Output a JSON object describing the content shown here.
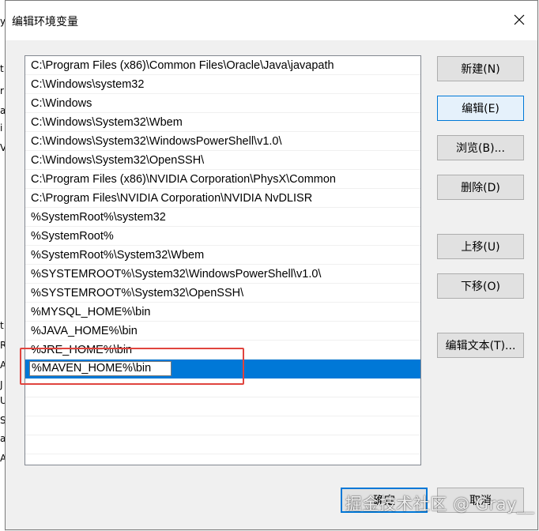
{
  "dialog": {
    "title": "编辑环境变量",
    "close_label": "×"
  },
  "behind_window_chars": [
    "y",
    "t",
    "r",
    "a",
    "i",
    "V",
    "t",
    "R",
    "A",
    "J",
    "U",
    "S",
    "a",
    "A"
  ],
  "paths": [
    "C:\\Program Files (x86)\\Common Files\\Oracle\\Java\\javapath",
    "C:\\Windows\\system32",
    "C:\\Windows",
    "C:\\Windows\\System32\\Wbem",
    "C:\\Windows\\System32\\WindowsPowerShell\\v1.0\\",
    "C:\\Windows\\System32\\OpenSSH\\",
    "C:\\Program Files (x86)\\NVIDIA Corporation\\PhysX\\Common",
    "C:\\Program Files\\NVIDIA Corporation\\NVIDIA NvDLISR",
    "%SystemRoot%\\system32",
    "%SystemRoot%",
    "%SystemRoot%\\System32\\Wbem",
    "%SYSTEMROOT%\\System32\\WindowsPowerShell\\v1.0\\",
    "%SYSTEMROOT%\\System32\\OpenSSH\\",
    "%MYSQL_HOME%\\bin",
    "%JAVA_HOME%\\bin",
    "%JRE_HOME%\\bin"
  ],
  "editing_entry": "%MAVEN_HOME%\\bin",
  "buttons": {
    "new": "新建(N)",
    "edit": "编辑(E)",
    "browse": "浏览(B)...",
    "delete": "删除(D)",
    "move_up": "上移(U)",
    "move_down": "下移(O)",
    "edit_text": "编辑文本(T)...",
    "ok": "确定",
    "cancel": "取消"
  },
  "colors": {
    "selection": "#0078d7",
    "highlight_box": "#e0443e"
  },
  "watermark": "掘金技术社区 @ Gray__"
}
